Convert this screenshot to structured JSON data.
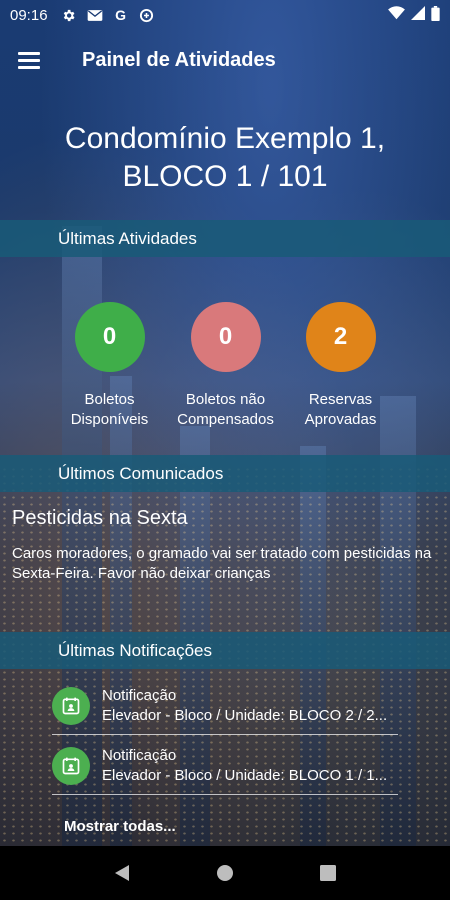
{
  "status_bar": {
    "time": "09:16",
    "icons": [
      "gear-icon",
      "mail-icon",
      "google-icon",
      "data-saver-icon",
      "wifi-icon",
      "signal-icon",
      "battery-icon"
    ],
    "google_letter": "G"
  },
  "app_bar": {
    "title": "Painel de Atividades",
    "menu_icon": "hamburger-menu-icon"
  },
  "condo": {
    "line1": "Condomínio Exemplo 1,",
    "line2": "BLOCO 1 / 101"
  },
  "sections": {
    "activities": "Últimas Atividades",
    "announcements": "Últimos Comunicados",
    "notifications": "Últimas Notificações"
  },
  "stats": [
    {
      "value": "0",
      "label_line1": "Boletos",
      "label_line2": "Disponíveis",
      "color": "#3fae49"
    },
    {
      "value": "0",
      "label_line1": "Boletos não",
      "label_line2": "Compensados",
      "color": "#d9797b"
    },
    {
      "value": "2",
      "label_line1": "Reservas",
      "label_line2": "Aprovadas",
      "color": "#e08419"
    }
  ],
  "announcement": {
    "title": "Pesticidas na Sexta",
    "body": "Caros moradores, o gramado vai ser tratado com pesticidas na Sexta-Feira. Favor não deixar crianças"
  },
  "notifications": [
    {
      "title": "Notificação",
      "subtitle": "Elevador - Bloco / Unidade: BLOCO 2 / 2...",
      "icon": "calendar-person-icon",
      "icon_color": "#4caf50"
    },
    {
      "title": "Notificação",
      "subtitle": "Elevador - Bloco / Unidade: BLOCO 1 / 1...",
      "icon": "calendar-person-icon",
      "icon_color": "#4caf50"
    }
  ],
  "show_all": "Mostrar todas...",
  "nav_bar": [
    "back-icon",
    "home-icon",
    "recents-icon"
  ]
}
